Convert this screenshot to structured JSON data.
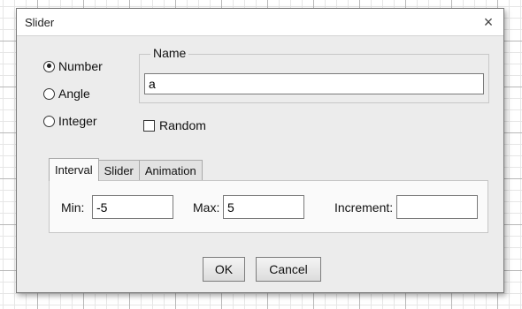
{
  "dialog": {
    "title": "Slider",
    "close_icon": "×"
  },
  "type_options": [
    {
      "label": "Number",
      "selected": true
    },
    {
      "label": "Angle",
      "selected": false
    },
    {
      "label": "Integer",
      "selected": false
    }
  ],
  "name": {
    "legend": "Name",
    "value": "a"
  },
  "random": {
    "label": "Random",
    "checked": false
  },
  "tabs": [
    {
      "label": "Interval",
      "active": true
    },
    {
      "label": "Slider",
      "active": false
    },
    {
      "label": "Animation",
      "active": false
    }
  ],
  "interval": {
    "min_label": "Min:",
    "min_value": "-5",
    "max_label": "Max:",
    "max_value": "5",
    "increment_label": "Increment:",
    "increment_value": ""
  },
  "buttons": {
    "ok": "OK",
    "cancel": "Cancel"
  }
}
